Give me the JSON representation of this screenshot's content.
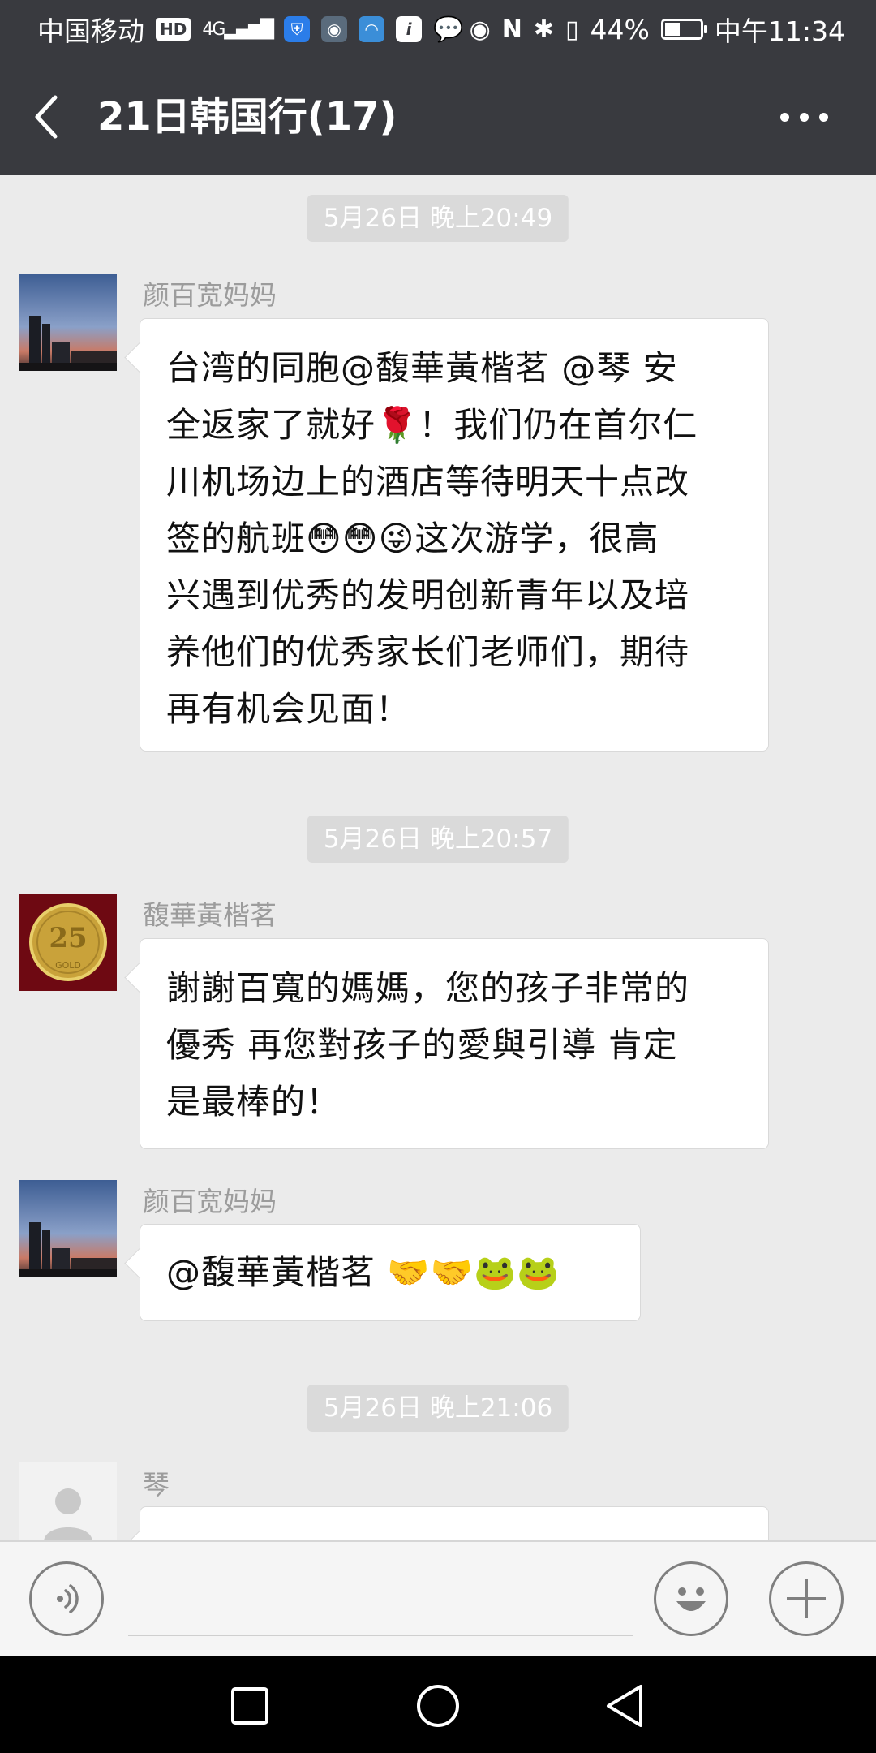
{
  "status_bar": {
    "carrier": "中国移动",
    "hd_badge": "HD",
    "network": "4G",
    "battery_percent": "44%",
    "battery_level": 0.44,
    "time": "中午11:34",
    "icons": [
      "hd-icon",
      "signal-icon",
      "shield-app-icon",
      "app-icon",
      "app-icon",
      "info-app-icon",
      "chat-bubble-icon",
      "eye-icon",
      "nfc-icon",
      "bluetooth-icon",
      "vibrate-icon",
      "battery-icon"
    ]
  },
  "header": {
    "title": "21日韩国行(17)",
    "back_icon": "chevron-left-icon",
    "more_icon": "more-horizontal-icon"
  },
  "messages": [
    {
      "timestamp": "5月26日 晚上20:49",
      "sender": "颜百宽妈妈",
      "lines": [
        "台湾的同胞@馥華黃楷茗 @琴  安",
        "全返家了就好🌹！我们仍在首尔仁",
        "川机场边上的酒店等待明天十点改",
        "签的航班😳😳😜这次游学，很高",
        "兴遇到优秀的发明创新青年以及培",
        "养他们的优秀家长们老师们，期待",
        "再有机会见面！"
      ]
    },
    {
      "timestamp": "5月26日 晚上20:57",
      "sender": "馥華黃楷茗",
      "avatar_text": "25",
      "avatar_sub": "GOLD",
      "lines": [
        "謝謝百寬的媽媽，您的孩子非常的",
        "優秀 再您對孩子的愛與引導 肯定",
        "是最棒的！"
      ]
    },
    {
      "sender": "颜百宽妈妈",
      "text": "@馥華黃楷茗  🤝🤝🐸🐸"
    },
    {
      "timestamp": "5月26日 晚上21:06",
      "sender": "琴"
    }
  ],
  "input_bar": {
    "voice_icon": "voice-icon",
    "emoji_icon": "smiley-icon",
    "plus_icon": "plus-icon"
  },
  "nav_bar": {
    "icons": [
      "recents-square-icon",
      "home-circle-icon",
      "back-triangle-icon"
    ]
  }
}
